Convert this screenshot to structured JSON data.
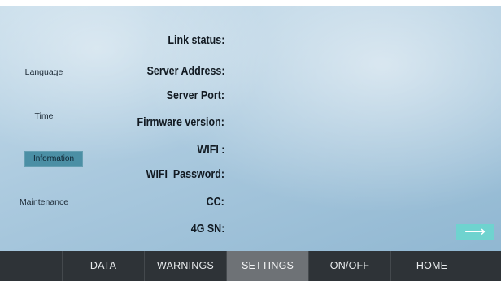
{
  "sidebar": {
    "items": [
      {
        "label": "Language"
      },
      {
        "label": "Time"
      },
      {
        "label": "Information"
      },
      {
        "label": "Maintenance"
      }
    ],
    "active": "Information"
  },
  "info": {
    "labels": [
      "Link status:",
      "Server Address:",
      "Server Port:",
      "Firmware version:",
      "WIFI :",
      "WIFI  Password:",
      "CC:",
      "4G SN:"
    ]
  },
  "next_button": {
    "icon": "arrow-right-icon",
    "glyph": "⟶"
  },
  "bottom_nav": {
    "tabs": [
      {
        "label": "DATA"
      },
      {
        "label": "WARNINGS"
      },
      {
        "label": "SETTINGS"
      },
      {
        "label": "ON/OFF"
      },
      {
        "label": "HOME"
      }
    ],
    "active": "SETTINGS"
  },
  "colors": {
    "accent_active_menu": "#4b8fa5",
    "next_button": "#6fd3cf",
    "nav_bar": "#2e3337",
    "nav_active": "#6e7276"
  }
}
